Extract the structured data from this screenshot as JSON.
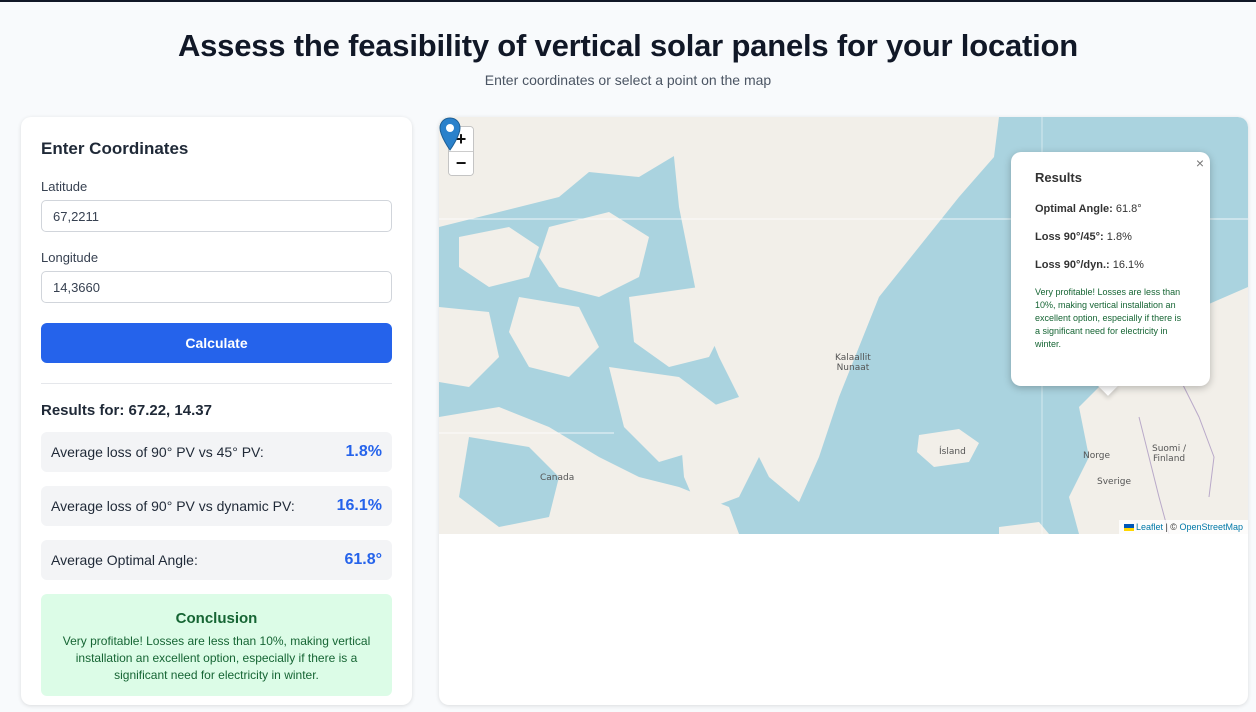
{
  "header": {
    "title": "Assess the feasibility of vertical solar panels for your location",
    "subtitle": "Enter coordinates or select a point on the map"
  },
  "form": {
    "heading": "Enter Coordinates",
    "latitude_label": "Latitude",
    "latitude_value": "67,2211",
    "longitude_label": "Longitude",
    "longitude_value": "14,3660",
    "calculate_label": "Calculate"
  },
  "results": {
    "heading": "Results for: 67.22, 14.37",
    "rows": [
      {
        "label": "Average loss of 90° PV vs 45° PV:",
        "value": "1.8%"
      },
      {
        "label": "Average loss of 90° PV vs dynamic PV:",
        "value": "16.1%"
      },
      {
        "label": "Average Optimal Angle:",
        "value": "61.8°"
      }
    ],
    "conclusion_title": "Conclusion",
    "conclusion_text": "Very profitable! Losses are less than 10%, making vertical installation an excellent option, especially if there is a significant need for electricity in winter."
  },
  "map": {
    "zoom_in": "+",
    "zoom_out": "−",
    "labels": {
      "greenland_1": "Kalaallit",
      "greenland_2": "Nunaat",
      "canada": "Canada",
      "iceland": "Ísland",
      "norway": "Norge",
      "finland_1": "Suomi /",
      "finland_2": "Finland",
      "sweden": "Sverige"
    },
    "popup": {
      "close": "×",
      "title": "Results",
      "optimal_label": "Optimal Angle:",
      "optimal_value": "61.8°",
      "loss45_label": "Loss 90°/45°:",
      "loss45_value": "1.8%",
      "lossdyn_label": "Loss 90°/dyn.:",
      "lossdyn_value": "16.1%",
      "note": "Very profitable! Losses are less than 10%, making vertical installation an excellent option, especially if there is a significant need for electricity in winter."
    },
    "attribution": {
      "leaflet": "Leaflet",
      "separator": " | © ",
      "osm": "OpenStreetMap"
    },
    "colors": {
      "water": "#aad3df",
      "land": "#f2efe9",
      "marker": "#2a81cb"
    }
  }
}
